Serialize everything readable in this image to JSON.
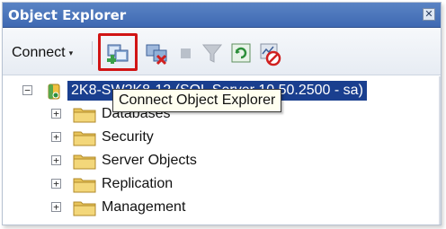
{
  "window": {
    "title": "Object Explorer",
    "close_glyph": "✕"
  },
  "toolbar": {
    "connect_label": "Connect",
    "connect_caret": "▾",
    "icons": [
      {
        "name": "connect-object-explorer-icon",
        "highlighted": true
      },
      {
        "name": "disconnect-icon",
        "highlighted": false
      },
      {
        "name": "stop-icon",
        "highlighted": false
      },
      {
        "name": "filter-icon",
        "highlighted": false
      },
      {
        "name": "refresh-icon",
        "highlighted": false
      },
      {
        "name": "activity-monitor-icon",
        "highlighted": false
      }
    ],
    "highlight_color": "#d11414"
  },
  "tooltip": {
    "text": "Connect Object Explorer"
  },
  "tree": {
    "server": {
      "label": "2K8-SW2K8-12 (SQL Server 10.50.2500 - sa)",
      "expander": "−",
      "selected": true
    },
    "children": [
      {
        "label": "Databases",
        "expander": "+"
      },
      {
        "label": "Security",
        "expander": "+"
      },
      {
        "label": "Server Objects",
        "expander": "+"
      },
      {
        "label": "Replication",
        "expander": "+"
      },
      {
        "label": "Management",
        "expander": "+"
      }
    ]
  },
  "colors": {
    "titlebar": "#3f69b2",
    "selection": "#1a3f8f",
    "tooltip_bg": "#fffff0",
    "folder": "#e8c45a"
  }
}
